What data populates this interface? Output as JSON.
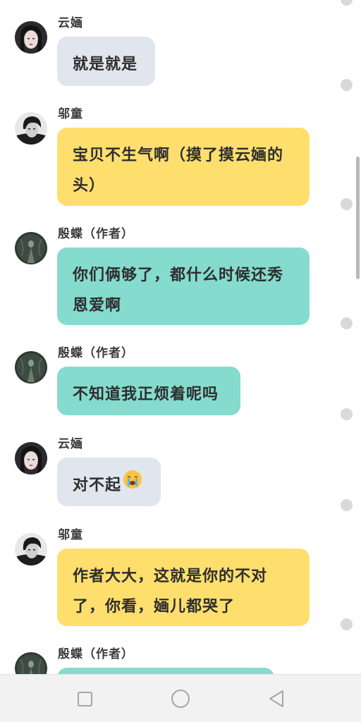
{
  "messages": [
    {
      "sender": "云婳",
      "lines": [
        "就是就是"
      ],
      "bubble_color": "#e1e6ee",
      "avatar": "girl-avatar-icon"
    },
    {
      "sender": "邬童",
      "lines": [
        "宝贝不生气啊（摸了摸云婳的",
        "头）"
      ],
      "bubble_color": "#fedf6e",
      "avatar": "boy-avatar-icon"
    },
    {
      "sender": "殷蝶（作者）",
      "lines": [
        "你们俩够了，都什么时候还秀",
        "恩爱啊"
      ],
      "bubble_color": "#85dbce",
      "avatar": "author-avatar-icon"
    },
    {
      "sender": "殷蝶（作者）",
      "lines": [
        "不知道我正烦着呢吗"
      ],
      "bubble_color": "#85dbce",
      "avatar": "author-avatar-icon"
    },
    {
      "sender": "云婳",
      "lines": [
        "对不起"
      ],
      "emoji": "crying-face-emoji",
      "bubble_color": "#e1e6ee",
      "avatar": "girl-avatar-icon"
    },
    {
      "sender": "邬童",
      "lines": [
        "作者大大，这就是你的不对",
        "了，你看，婳儿都哭了"
      ],
      "bubble_color": "#fedf6e",
      "avatar": "boy-avatar-icon"
    },
    {
      "sender": "殷蝶（作者）",
      "lines": [],
      "bubble_color": "#85dbce",
      "avatar": "author-avatar-icon"
    }
  ],
  "navbar": {
    "buttons": [
      "recent-apps-square-icon",
      "home-circle-icon",
      "back-triangle-icon"
    ],
    "background": "#f2f2f2"
  }
}
